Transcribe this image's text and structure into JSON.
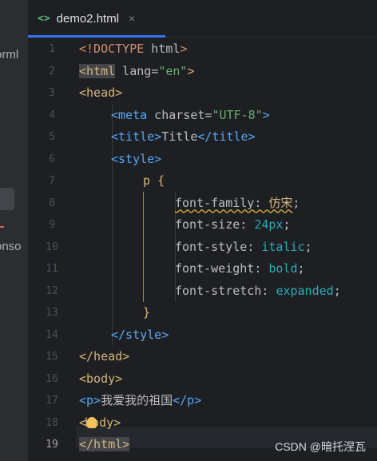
{
  "left_panel": {
    "text_top": "orml",
    "text_bottom": "onso"
  },
  "tab": {
    "icon": "<>",
    "label": "demo2.html",
    "close": "×"
  },
  "line_numbers": [
    "1",
    "2",
    "3",
    "4",
    "5",
    "6",
    "7",
    "8",
    "9",
    "10",
    "11",
    "12",
    "13",
    "14",
    "15",
    "16",
    "17",
    "18",
    "19"
  ],
  "code": {
    "l1": {
      "a": "<!DOCTYPE",
      "b": " html",
      "c": ">"
    },
    "l2": {
      "a": "<html",
      "b": " lang=",
      "c": "\"en\"",
      "d": ">"
    },
    "l3": {
      "a": "<head>"
    },
    "l4": {
      "a": "<meta",
      "b": " charset=",
      "c": "\"UTF-8\"",
      "d": ">"
    },
    "l5": {
      "a": "<title>",
      "b": "Title",
      "c": "</title>"
    },
    "l6": {
      "a": "<style>"
    },
    "l7": {
      "a": "p ",
      "b": "{"
    },
    "l8": {
      "a": "font-family",
      "b": ": ",
      "c": "仿宋",
      "d": ";"
    },
    "l9": {
      "a": "font-size",
      "b": ": ",
      "c": "24px",
      "d": ";"
    },
    "l10": {
      "a": "font-style",
      "b": ": ",
      "c": "italic",
      "d": ";"
    },
    "l11": {
      "a": "font-weight",
      "b": ": ",
      "c": "bold",
      "d": ";"
    },
    "l12": {
      "a": "font-stretch",
      "b": ": ",
      "c": "expanded",
      "d": ";"
    },
    "l13": {
      "a": "}"
    },
    "l14": {
      "a": "</style>"
    },
    "l15": {
      "a": "</head>"
    },
    "l16": {
      "a": "<body>"
    },
    "l17": {
      "a": "<p>",
      "b": "我爱我的祖国",
      "c": "</p>"
    },
    "l18": {
      "a": "<",
      "b": "body>"
    },
    "l19": {
      "a": "</html>"
    }
  },
  "watermark": "CSDN @暗托涅瓦"
}
